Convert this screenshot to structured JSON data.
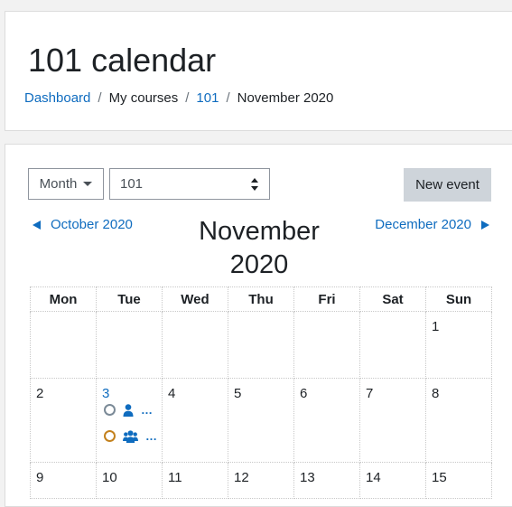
{
  "page": {
    "title": "101 calendar"
  },
  "breadcrumb": [
    {
      "label": "Dashboard",
      "link": true
    },
    {
      "label": "My courses",
      "link": false
    },
    {
      "label": "101",
      "link": true
    },
    {
      "label": "November 2020",
      "link": false
    }
  ],
  "breadcrumb_separator": "/",
  "controls": {
    "view_label": "Month",
    "course_selected": "101",
    "new_event_label": "New event"
  },
  "navigation": {
    "prev_label": "October 2020",
    "current_line1": "November",
    "current_line2": "2020",
    "next_label": "December 2020"
  },
  "weekdays": [
    "Mon",
    "Tue",
    "Wed",
    "Thu",
    "Fri",
    "Sat",
    "Sun"
  ],
  "days": {
    "d1": "1",
    "d2": "2",
    "d3": "3",
    "d4": "4",
    "d5": "5",
    "d6": "6",
    "d7": "7",
    "d8": "8",
    "d9": "9",
    "d10": "10",
    "d11": "11",
    "d12": "12",
    "d13": "13",
    "d14": "14",
    "d15": "15"
  },
  "events": [
    {
      "day": "3",
      "icon": "user-icon",
      "status_color": "#7b8a97",
      "text": "…"
    },
    {
      "day": "3",
      "icon": "users-icon",
      "status_color": "#c3811d",
      "text": "…"
    }
  ]
}
